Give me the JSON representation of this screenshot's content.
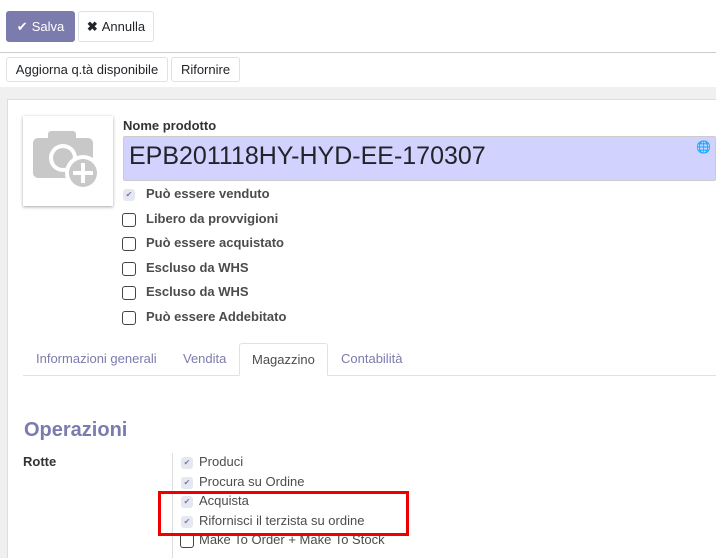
{
  "toolbar": {
    "save": "Salva",
    "cancel": "Annulla"
  },
  "actions": {
    "update_qty": "Aggiorna q.tà disponibile",
    "replenish": "Rifornire"
  },
  "product": {
    "name_label": "Nome prodotto",
    "name": "EPB201118HY-HYD-EE-170307"
  },
  "options": [
    {
      "label": "Può essere venduto",
      "checked": true
    },
    {
      "label": "Libero da provvigioni",
      "checked": false
    },
    {
      "label": "Può essere acquistato",
      "checked": false
    },
    {
      "label": "Escluso da WHS",
      "checked": false
    },
    {
      "label": "Escluso da WHS",
      "checked": false
    },
    {
      "label": "Può essere Addebitato",
      "checked": false
    }
  ],
  "tabs": [
    "Informazioni generali",
    "Vendita",
    "Magazzino",
    "Contabilità"
  ],
  "section": {
    "title": "Operazioni",
    "routes_label": "Rotte"
  },
  "routes": [
    {
      "label": "Produci",
      "checked": true
    },
    {
      "label": "Procura su Ordine",
      "checked": true
    },
    {
      "label": "Acquista",
      "checked": true
    },
    {
      "label": "Rifornisci il terzista su ordine",
      "checked": true
    },
    {
      "label": "Make To Order + Make To Stock",
      "checked": false
    }
  ],
  "highlight_color": "#ee0000"
}
